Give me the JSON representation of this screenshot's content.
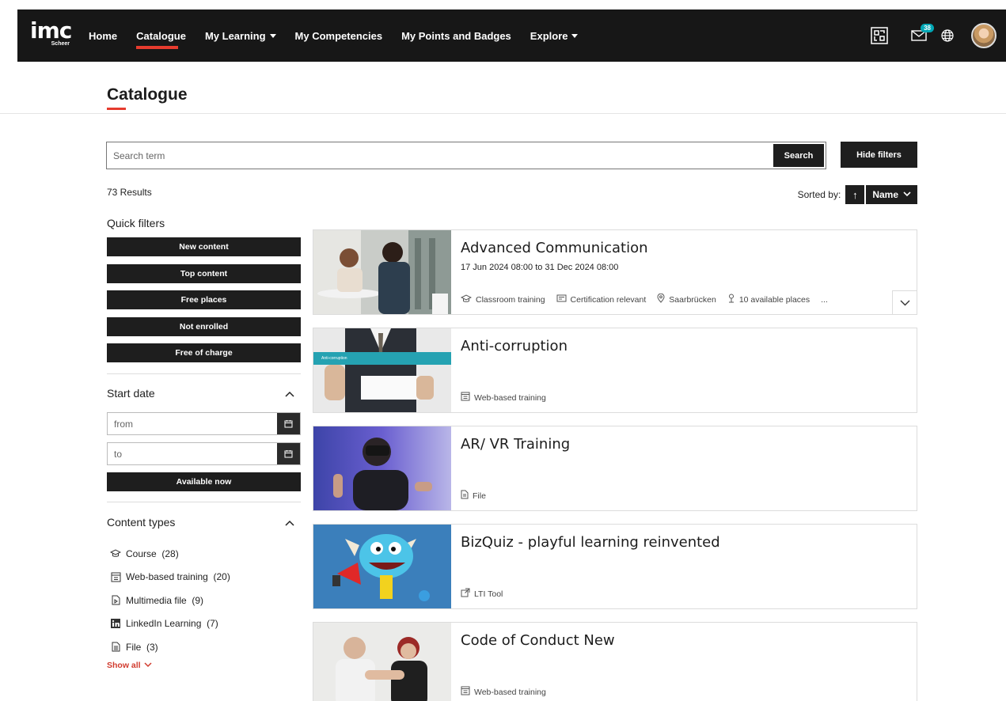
{
  "nav": {
    "logo_text": "imc",
    "logo_sub": "Scheer",
    "items": [
      {
        "label": "Home",
        "dropdown": false,
        "active": false
      },
      {
        "label": "Catalogue",
        "dropdown": false,
        "active": true
      },
      {
        "label": "My Learning",
        "dropdown": true,
        "active": false
      },
      {
        "label": "My Competencies",
        "dropdown": false,
        "active": false
      },
      {
        "label": "My Points and Badges",
        "dropdown": false,
        "active": false
      },
      {
        "label": "Explore",
        "dropdown": true,
        "active": false
      }
    ],
    "messages_badge": "38",
    "icons": [
      "qr-scan-icon",
      "mail-icon",
      "globe-icon",
      "user-avatar"
    ]
  },
  "page": {
    "title": "Catalogue"
  },
  "search": {
    "placeholder": "Search term",
    "value": "",
    "search_label": "Search",
    "hide_filters_label": "Hide filters"
  },
  "results": {
    "count_text": "73 Results",
    "sorted_by_label": "Sorted by:",
    "sort_direction": "↑",
    "sort_field": "Name"
  },
  "sidebar": {
    "quick_filters_title": "Quick filters",
    "quick_filters": [
      "New content",
      "Top content",
      "Free places",
      "Not enrolled",
      "Free of charge"
    ],
    "start_date": {
      "title": "Start date",
      "from_placeholder": "from",
      "to_placeholder": "to",
      "available_now_label": "Available now"
    },
    "content_types": {
      "title": "Content types",
      "items": [
        {
          "icon": "graduation-cap-icon",
          "label": "Course",
          "count": "(28)"
        },
        {
          "icon": "web-training-icon",
          "label": "Web-based training",
          "count": "(20)"
        },
        {
          "icon": "multimedia-file-icon",
          "label": "Multimedia file",
          "count": "(9)"
        },
        {
          "icon": "linkedin-icon",
          "label": "LinkedIn Learning",
          "count": "(7)"
        },
        {
          "icon": "file-icon",
          "label": "File",
          "count": "(3)"
        }
      ],
      "show_all_label": "Show all"
    }
  },
  "cards": [
    {
      "title": "Advanced Communication",
      "subtitle": "17 Jun 2024 08:00 to 31 Dec 2024 08:00",
      "meta": [
        {
          "icon": "classroom-icon",
          "label": "Classroom training"
        },
        {
          "icon": "certificate-icon",
          "label": "Certification relevant"
        },
        {
          "icon": "location-icon",
          "label": "Saarbrücken"
        },
        {
          "icon": "places-icon",
          "label": "10 available places"
        },
        {
          "icon": "",
          "label": "..."
        }
      ],
      "expandable": true
    },
    {
      "title": "Anti-corruption",
      "subtitle": "",
      "image_caption": "Anti-corruption",
      "meta": [
        {
          "icon": "web-training-icon",
          "label": "Web-based training"
        }
      ],
      "expandable": false
    },
    {
      "title": "AR/ VR Training",
      "subtitle": "",
      "meta": [
        {
          "icon": "file-icon",
          "label": "File"
        }
      ],
      "expandable": false
    },
    {
      "title": "BizQuiz - playful learning reinvented",
      "subtitle": "",
      "meta": [
        {
          "icon": "lti-tool-icon",
          "label": "LTI Tool"
        }
      ],
      "expandable": false
    },
    {
      "title": "Code of Conduct New",
      "subtitle": "",
      "meta": [
        {
          "icon": "web-training-icon",
          "label": "Web-based training"
        }
      ],
      "expandable": false
    }
  ]
}
